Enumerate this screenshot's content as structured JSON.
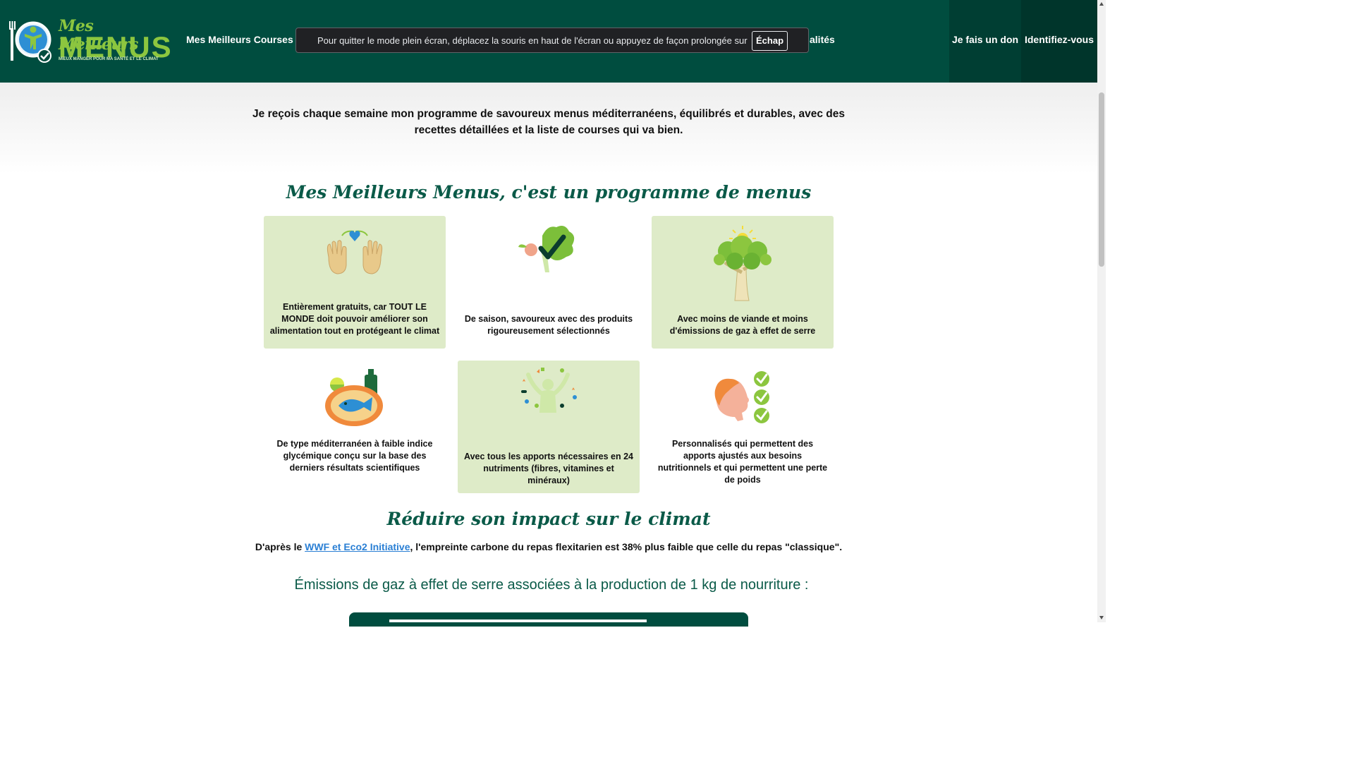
{
  "header": {
    "logo_script": "Mes Meilleurs",
    "logo_big": "MENUS",
    "logo_tagline": "MIEUX MANGER POUR MA SANTÉ ET LE CLIMAT",
    "nav_courses": "Mes Meilleurs Courses",
    "nav_partial": "alités",
    "nav_don": "Je fais un don",
    "nav_login": "Identifiez-vous",
    "bg_color": "#004d3f",
    "accent_color": "#8cc63f"
  },
  "fullscreen_toast": {
    "message": "Pour quitter le mode plein écran, déplacez la souris en haut de l'écran ou appuyez de façon prolongée sur",
    "key": "Échap"
  },
  "intro": {
    "text": "Je reçois chaque semaine mon programme de savoureux menus méditerranéens, équilibrés et durables, avec des recettes détaillées et la liste de courses qui va bien."
  },
  "program": {
    "title": "Mes Meilleurs Menus, c'est un programme de menus",
    "cards": [
      {
        "icon": "hands-heart-icon",
        "text": "Entièrement gratuits, car TOUT LE MONDE doit pouvoir améliorer son alimentation tout en protégeant le climat"
      },
      {
        "icon": "vegetables-check-icon",
        "text": "De saison, savoureux avec des produits rigoureusement sélectionnés"
      },
      {
        "icon": "tree-sun-icon",
        "text": "Avec moins de viande et moins d'émissions de gaz à effet de serre"
      },
      {
        "icon": "fish-plate-icon",
        "text": "De type méditerranéen à faible indice glycémique conçu sur la base des derniers résultats scientifiques"
      },
      {
        "icon": "person-nutrients-icon",
        "text": "Avec tous les apports nécessaires en 24 nutriments (fibres, vitamines et minéraux)"
      },
      {
        "icon": "head-checklist-icon",
        "text": "Personnalisés qui permettent des apports ajustés aux besoins nutritionnels et qui permettent une perte de poids"
      }
    ]
  },
  "climate": {
    "title": "Réduire son impact sur le climat",
    "prefix": "D'après le ",
    "link": "WWF et Eco2 Initiative",
    "suffix": ", l'empreinte carbone du repas flexitarien est 38% plus faible que celle du repas \"classique\".",
    "emissions_heading": "Émissions de gaz à effet de serre associées à la production de 1 kg de nourriture :"
  }
}
